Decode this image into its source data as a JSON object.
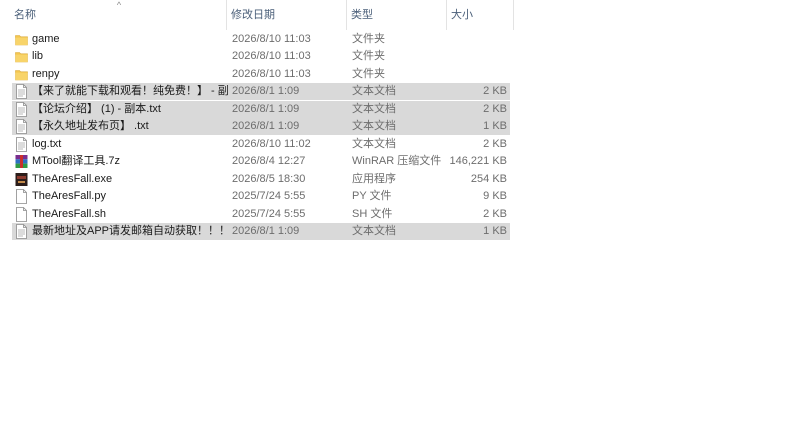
{
  "header": {
    "name": "名称",
    "date": "修改日期",
    "type": "类型",
    "size": "大小",
    "sort_indicator": "^"
  },
  "files": [
    {
      "name": "game",
      "date": "2026/8/10 11:03",
      "type": "文件夹",
      "size": "",
      "icon": "folder-icon",
      "selected": false
    },
    {
      "name": "lib",
      "date": "2026/8/10 11:03",
      "type": "文件夹",
      "size": "",
      "icon": "folder-icon",
      "selected": false
    },
    {
      "name": "renpy",
      "date": "2026/8/10 11:03",
      "type": "文件夹",
      "size": "",
      "icon": "folder-icon",
      "selected": false
    },
    {
      "name": "【来了就能下载和观看！纯免费！】 - 副…",
      "date": "2026/8/1 1:09",
      "type": "文本文档",
      "size": "2 KB",
      "icon": "text-file-icon",
      "selected": true
    },
    {
      "name": "【论坛介绍】 (1) - 副本.txt",
      "date": "2026/8/1 1:09",
      "type": "文本文档",
      "size": "2 KB",
      "icon": "text-file-icon",
      "selected": true
    },
    {
      "name": "【永久地址发布页】 .txt",
      "date": "2026/8/1 1:09",
      "type": "文本文档",
      "size": "1 KB",
      "icon": "text-file-icon",
      "selected": true
    },
    {
      "name": "log.txt",
      "date": "2026/8/10 11:02",
      "type": "文本文档",
      "size": "2 KB",
      "icon": "text-file-icon",
      "selected": false
    },
    {
      "name": "MTool翻译工具.7z",
      "date": "2026/8/4 12:27",
      "type": "WinRAR 压缩文件",
      "size": "146,221 KB",
      "icon": "winrar-archive-icon",
      "selected": false
    },
    {
      "name": "TheAresFall.exe",
      "date": "2026/8/5 18:30",
      "type": "应用程序",
      "size": "254 KB",
      "icon": "application-icon",
      "selected": false
    },
    {
      "name": "TheAresFall.py",
      "date": "2025/7/24 5:55",
      "type": "PY 文件",
      "size": "9 KB",
      "icon": "blank-file-icon",
      "selected": false
    },
    {
      "name": "TheAresFall.sh",
      "date": "2025/7/24 5:55",
      "type": "SH 文件",
      "size": "2 KB",
      "icon": "blank-file-icon",
      "selected": false
    },
    {
      "name": "最新地址及APP请发邮箱自动获取！！！...",
      "date": "2026/8/1 1:09",
      "type": "文本文档",
      "size": "1 KB",
      "icon": "text-file-icon",
      "selected": true
    }
  ],
  "colors": {
    "folder": "#f4c64e",
    "selection": "#d9d9d9",
    "header_text": "#4c607a"
  }
}
